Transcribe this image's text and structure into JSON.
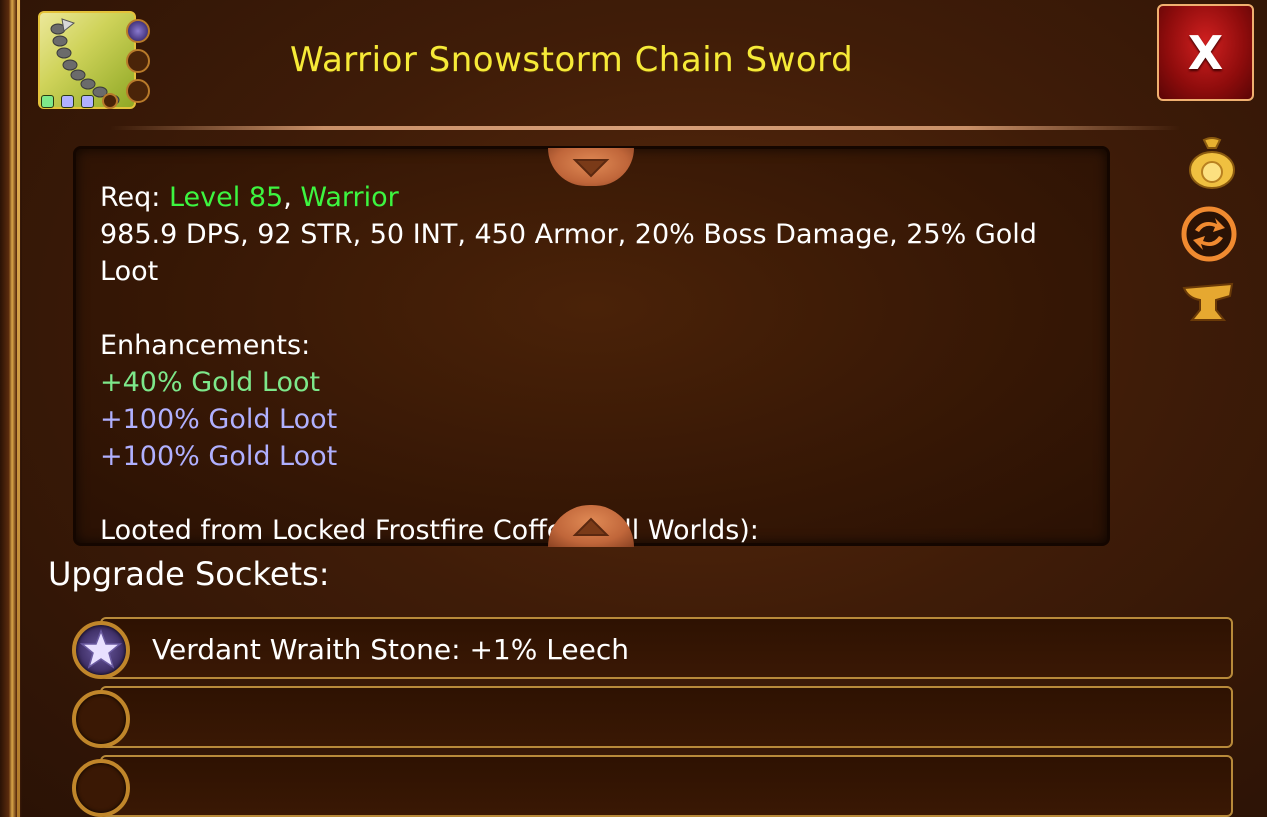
{
  "item": {
    "title": "Warrior Snowstorm Chain Sword",
    "icon": "chain-sword-icon",
    "gem_dot_colors": [
      "#7de88a",
      "#b0b0ff",
      "#b0b0ff"
    ]
  },
  "close_button": {
    "label": "X"
  },
  "description": {
    "req_label": "Req: ",
    "req_level": "Level 85",
    "req_sep": ", ",
    "req_class": "Warrior",
    "stats_line1": "985.9 DPS, 92 STR, 50 INT, 450 Armor, 20% Boss Damage, 25% Gold",
    "stats_line2": "Loot",
    "enhancements_label": "Enhancements:",
    "enhancements": [
      "+40% Gold Loot",
      "+100% Gold Loot",
      "+100% Gold Loot"
    ],
    "cutoff_line": "Looted from Locked Frostfire Coffers (all Worlds):"
  },
  "side_actions": [
    "gold-bag-icon",
    "swap-icon",
    "anvil-icon"
  ],
  "sockets": {
    "label": "Upgrade Sockets:",
    "rows": [
      "Verdant Wraith Stone: +1% Leech",
      "",
      ""
    ]
  },
  "colors": {
    "title": "#f6ea38",
    "requirement": "#3df540",
    "enhancement_green": "#7de88a",
    "enhancement_blue": "#b0b0ff",
    "close_red": "#b81414"
  }
}
